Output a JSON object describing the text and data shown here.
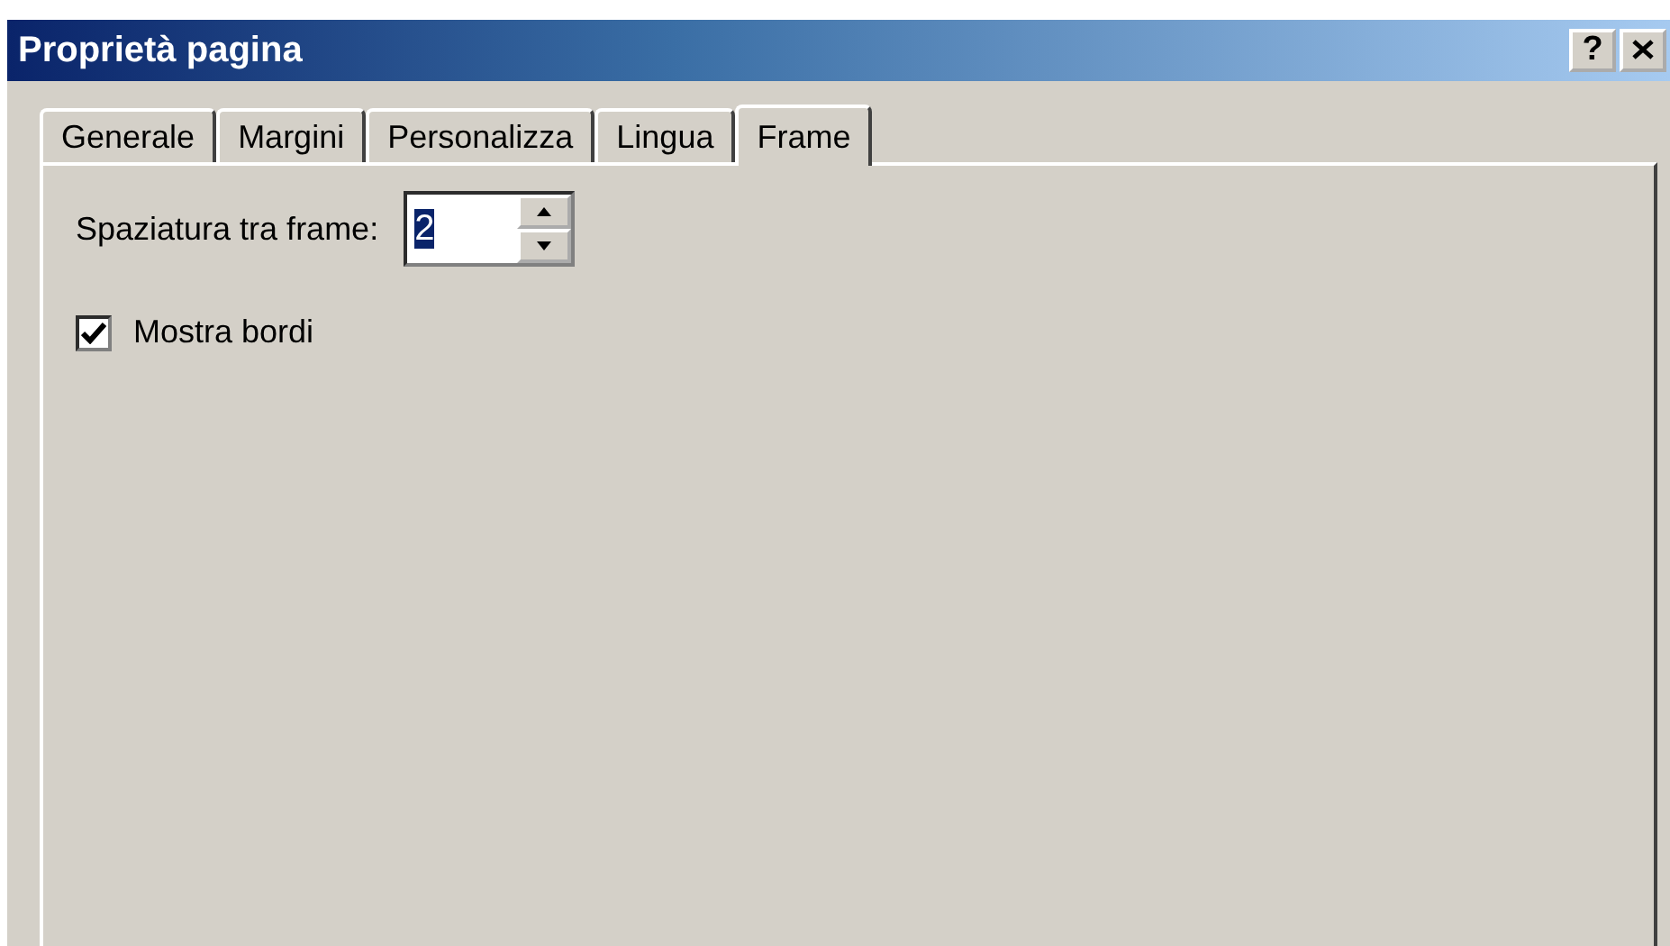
{
  "window": {
    "title": "Proprietà pagina"
  },
  "title_buttons": [
    {
      "kind": "help",
      "label": "?"
    },
    {
      "kind": "close"
    }
  ],
  "tabs": [
    {
      "label": "Generale",
      "selected": false
    },
    {
      "label": "Margini",
      "selected": false
    },
    {
      "label": "Personalizza",
      "selected": false
    },
    {
      "label": "Lingua",
      "selected": false
    },
    {
      "label": "Frame",
      "selected": true
    }
  ],
  "spacing": {
    "label": "Spaziatura tra frame:",
    "value": "2"
  },
  "show_borders": {
    "label": "Mostra bordi",
    "checked": true
  }
}
